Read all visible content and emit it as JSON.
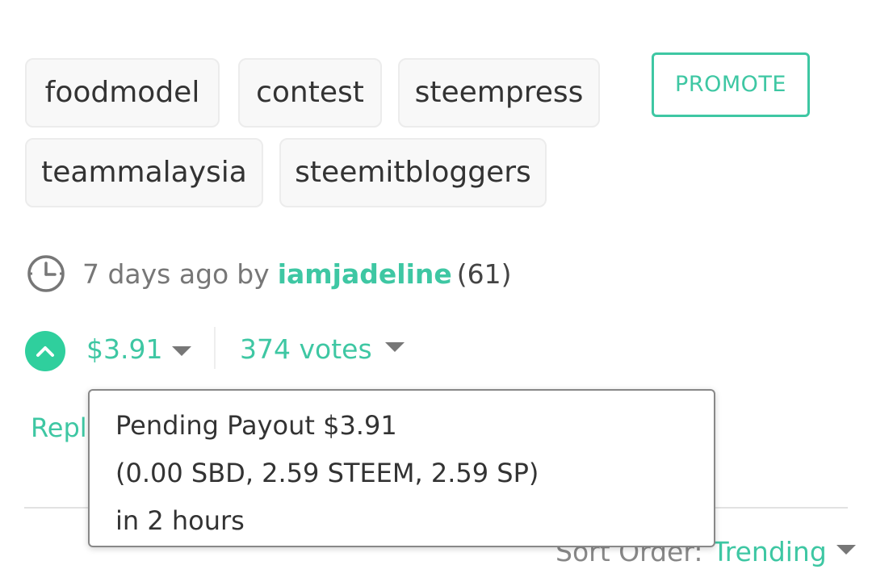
{
  "tags": [
    "foodmodel",
    "contest",
    "steempress",
    "teammalaysia",
    "steemitbloggers"
  ],
  "promote_label": "PROMOTE",
  "meta": {
    "time": "7 days ago",
    "by": "by",
    "author": "iamjadeline",
    "reputation": "(61)"
  },
  "payout": {
    "amount": "$3.91",
    "votes": "374 votes"
  },
  "reply_label": "Repl",
  "tooltip": {
    "line1": "Pending Payout $3.91",
    "line2": "(0.00 SBD, 2.59 STEEM, 2.59 SP)",
    "line3": "in 2 hours"
  },
  "sort": {
    "label": "Sort Order:",
    "value": "Trending"
  },
  "colors": {
    "accent": "#3ec7a3",
    "vote_button": "#2fcf9d",
    "muted_text": "#777777"
  },
  "icons": {
    "clock": "clock-icon",
    "upvote": "chevron-up-icon",
    "dropdown": "caret-down-icon"
  }
}
